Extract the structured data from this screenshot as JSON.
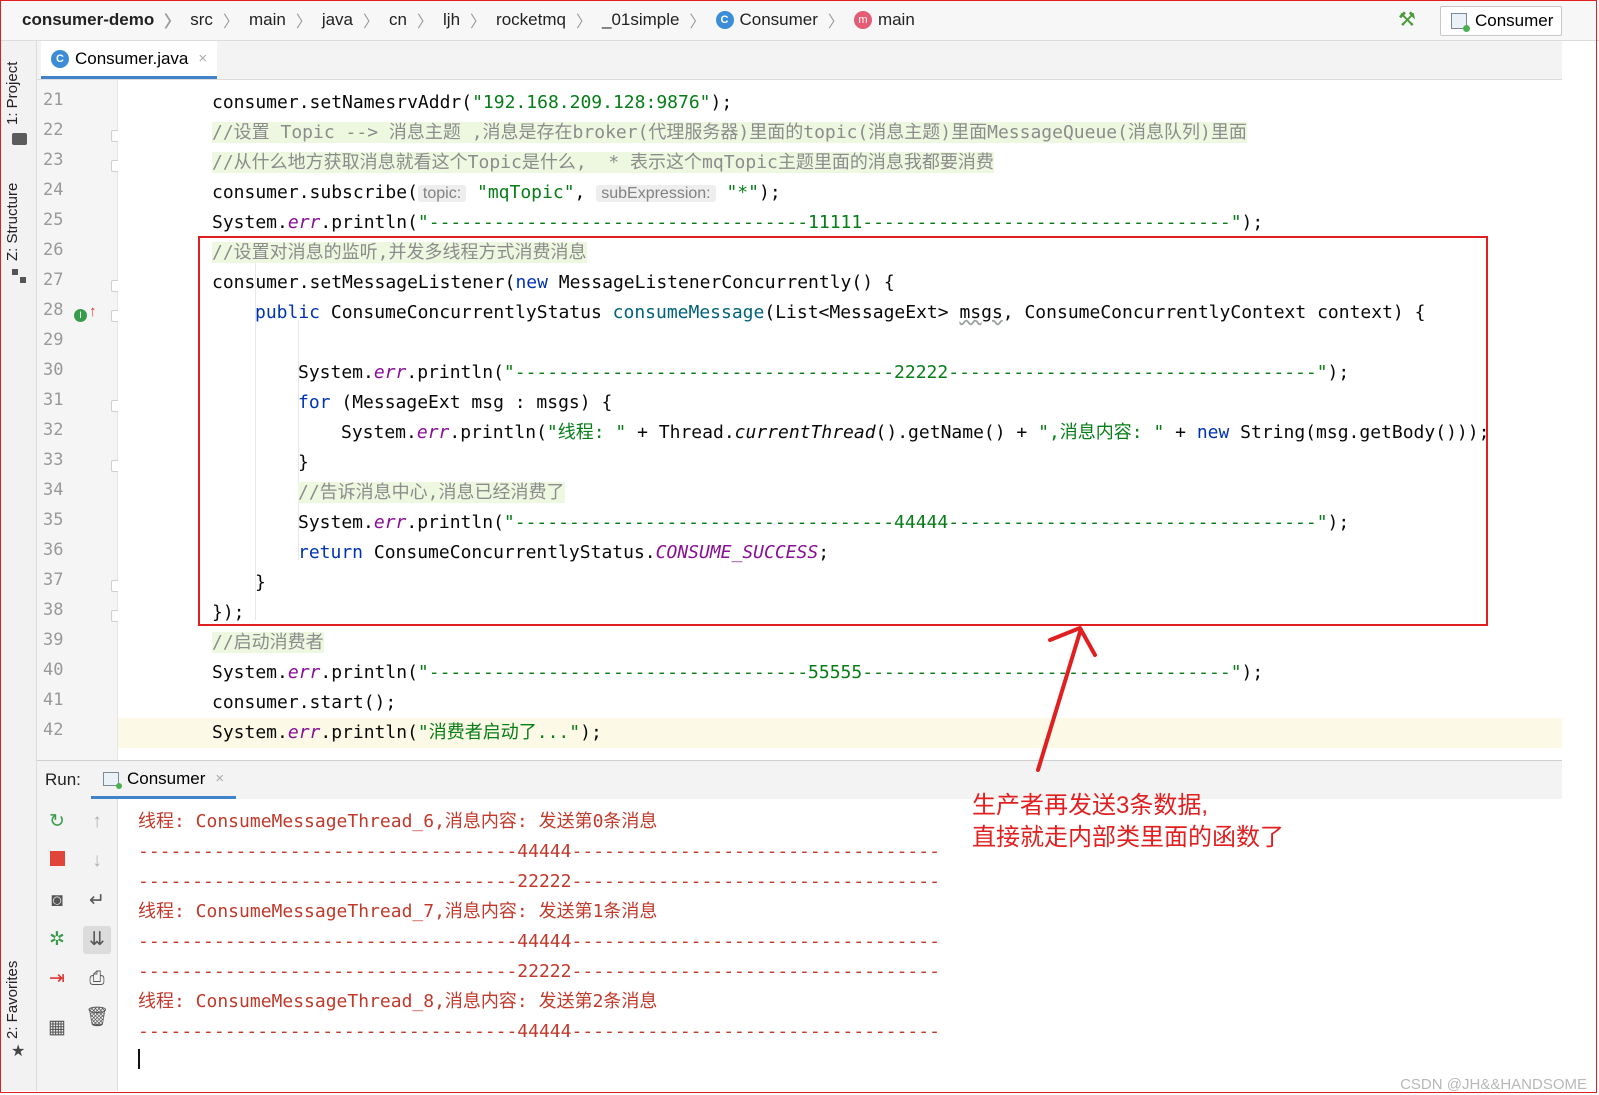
{
  "breadcrumb": {
    "project": "consumer-demo",
    "segments": [
      "src",
      "main",
      "java",
      "cn",
      "ljh",
      "rocketmq",
      "_01simple"
    ],
    "class_name": "Consumer",
    "class_icon": "C",
    "method_name": "main",
    "method_icon": "m"
  },
  "toolbar": {
    "build_icon": "hammer-icon",
    "run_config": "Consumer"
  },
  "side_tabs": {
    "project": "1: Project",
    "structure": "Z: Structure",
    "favorites": "2: Favorites"
  },
  "editor": {
    "tab_label": "Consumer.java",
    "tab_icon": "C",
    "tab_close": "×",
    "line_numbers": [
      "21",
      "22",
      "23",
      "24",
      "25",
      "26",
      "27",
      "28",
      "29",
      "30",
      "31",
      "32",
      "33",
      "34",
      "35",
      "36",
      "37",
      "38",
      "39",
      "40",
      "41",
      "42"
    ],
    "lines": {
      "l21": {
        "a": "consumer.setNamesrvAddr(",
        "s": "\"192.168.209.128:9876\"",
        "b": ");"
      },
      "l22": "//设置 Topic --> 消息主题 ,消息是存在broker(代理服务器)里面的topic(消息主题)里面MessageQueue(消息队列)里面",
      "l23": "//从什么地方获取消息就看这个Topic是什么,  * 表示这个mqTopic主题里面的消息我都要消费",
      "l24": {
        "a": "consumer.subscribe(",
        "h1": "topic:",
        "s1": "\"mqTopic\"",
        "c": ", ",
        "h2": "subExpression:",
        "s2": "\"*\"",
        "b": ");"
      },
      "l25": {
        "a": "System.",
        "f": "err",
        "p": ".println(",
        "s": "\"-----------------------------------11111----------------------------------\"",
        "b": ");"
      },
      "l26": "//设置对消息的监听,并发多线程方式消费消息",
      "l27": {
        "a": "consumer.setMessageListener(",
        "k": "new",
        "b": " MessageListenerConcurrently() {"
      },
      "l28": {
        "k": "public",
        "a": " ConsumeConcurrentlyStatus ",
        "m": "consumeMessage",
        "b": "(List<MessageExt> ",
        "w": "msgs",
        "c": ", ConsumeConcurrentlyContext context) {"
      },
      "l30": {
        "a": "System.",
        "f": "err",
        "p": ".println(",
        "s": "\"-----------------------------------22222----------------------------------\"",
        "b": ");"
      },
      "l31": {
        "k": "for",
        "a": " (MessageExt msg : msgs) {"
      },
      "l32": {
        "a": "System.",
        "f": "err",
        "p": ".println(",
        "s1": "\"线程: \"",
        "b1": " + Thread.",
        "i": "currentThread",
        "b2": "().getName() + ",
        "s2": "\",消息内容: \"",
        "b3": " + ",
        "k": "new",
        "b4": " String(msg.getBody()));"
      },
      "l33": "}",
      "l34": "//告诉消息中心,消息已经消费了",
      "l35": {
        "a": "System.",
        "f": "err",
        "p": ".println(",
        "s": "\"-----------------------------------44444----------------------------------\"",
        "b": ");"
      },
      "l36": {
        "k": "return",
        "a": " ConsumeConcurrentlyStatus.",
        "f": "CONSUME_SUCCESS",
        "b": ";"
      },
      "l37": "}",
      "l38": "});",
      "l39": "//启动消费者",
      "l40": {
        "a": "System.",
        "f": "err",
        "p": ".println(",
        "s": "\"-----------------------------------55555----------------------------------\"",
        "b": ");"
      },
      "l41": "consumer.start();",
      "l42": {
        "a": "System.",
        "f": "err",
        "p": ".println(",
        "s": "\"消费者启动了...\"",
        "b": ");"
      }
    }
  },
  "run": {
    "label": "Run:",
    "tab_label": "Consumer",
    "tab_close": "×",
    "output": [
      "线程: ConsumeMessageThread_6,消息内容: 发送第0条消息",
      "-----------------------------------44444----------------------------------",
      "-----------------------------------22222----------------------------------",
      "线程: ConsumeMessageThread_7,消息内容: 发送第1条消息",
      "-----------------------------------44444----------------------------------",
      "-----------------------------------22222----------------------------------",
      "线程: ConsumeMessageThread_8,消息内容: 发送第2条消息",
      "-----------------------------------44444----------------------------------"
    ]
  },
  "annotation": "生产者再发送3条数据,\n直接就走内部类里面的函数了",
  "watermark": "CSDN @JH&&HANDSOME",
  "colors": {
    "keyword": "#0033b3",
    "string": "#067d17",
    "field": "#871094",
    "comment": "#8c8c8c",
    "console_error": "#c0392b",
    "annotation": "#e02020"
  }
}
